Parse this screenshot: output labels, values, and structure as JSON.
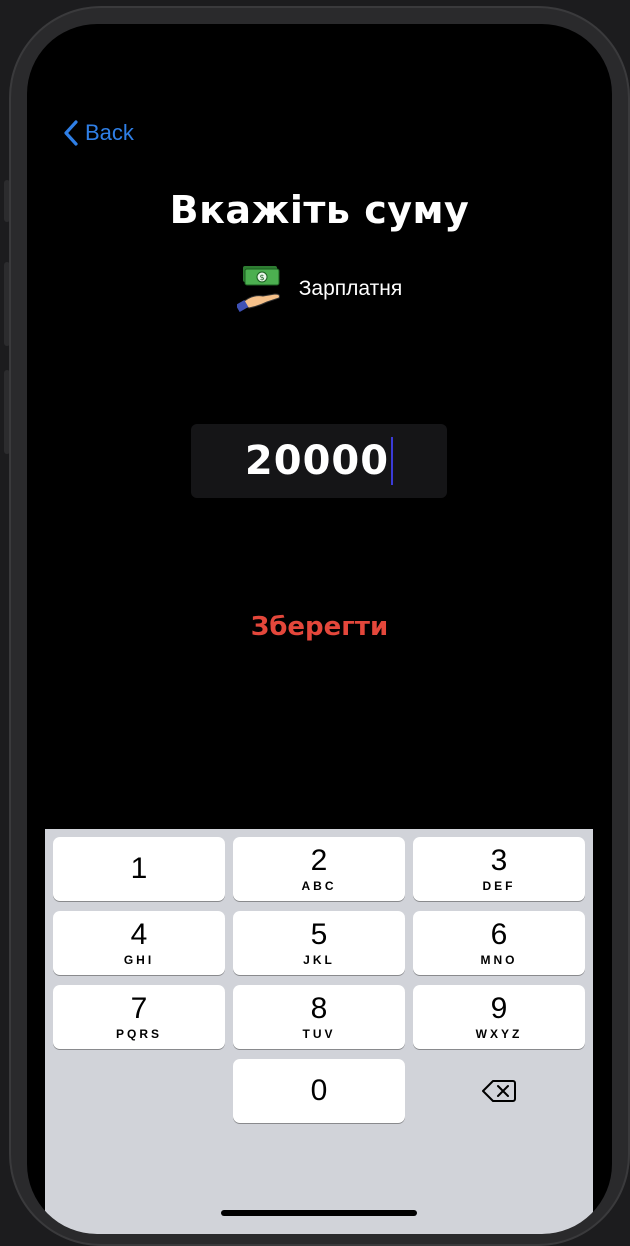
{
  "nav": {
    "back_label": "Back"
  },
  "screen": {
    "title": "Вкажіть суму",
    "category": {
      "label": "Зарплатня",
      "icon": "money-hand-icon"
    }
  },
  "amount": {
    "value": "20000"
  },
  "actions": {
    "save_label": "Зберегти"
  },
  "keypad": {
    "keys": [
      {
        "digit": "1",
        "letters": ""
      },
      {
        "digit": "2",
        "letters": "ABC"
      },
      {
        "digit": "3",
        "letters": "DEF"
      },
      {
        "digit": "4",
        "letters": "GHI"
      },
      {
        "digit": "5",
        "letters": "JKL"
      },
      {
        "digit": "6",
        "letters": "MNO"
      },
      {
        "digit": "7",
        "letters": "PQRS"
      },
      {
        "digit": "8",
        "letters": "TUV"
      },
      {
        "digit": "9",
        "letters": "WXYZ"
      },
      {
        "digit": "0",
        "letters": ""
      }
    ],
    "delete_icon": "backspace-icon"
  },
  "colors": {
    "accent": "#2f7fe6",
    "save": "#e4473b",
    "background": "#000000",
    "keyboard": "#d1d3d9"
  }
}
